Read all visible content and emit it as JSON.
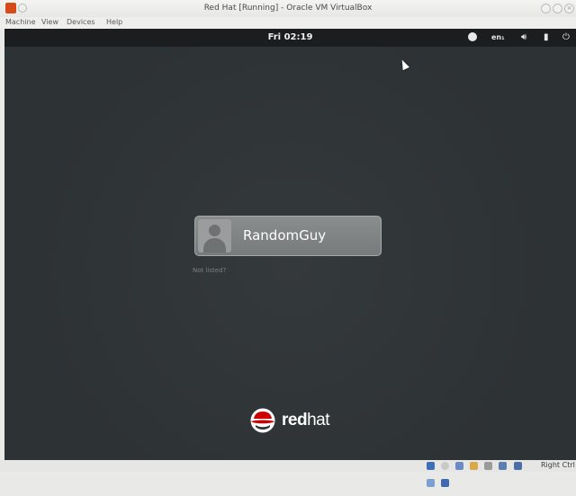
{
  "window": {
    "title": "Red Hat [Running] - Oracle VM VirtualBox",
    "controls": [
      "minimize",
      "maximize",
      "close"
    ]
  },
  "menubar": {
    "items": [
      "Machine",
      "View",
      "Devices",
      "Help"
    ]
  },
  "guest": {
    "topbar": {
      "clock": "Fri 02:19",
      "input_language": "en₁",
      "icons": [
        "accessibility-icon",
        "keyboard-layout-indicator",
        "volume-icon",
        "battery-icon",
        "power-icon"
      ]
    },
    "login": {
      "user_name": "RandomGuy",
      "not_listed_label": "Not listed?"
    },
    "branding": {
      "logo_text_bold": "red",
      "logo_text_light": "hat"
    }
  },
  "statusbar": {
    "host_key_label": "Right Ctrl",
    "device_icons": [
      "hard-disk-icon",
      "optical-drive-icon",
      "usb-icon",
      "shared-folders-icon",
      "display-icon",
      "network-icon",
      "video-capture-icon",
      "mouse-integration-icon",
      "host-key-icon"
    ]
  },
  "colors": {
    "guest_background": "#2e3436",
    "guest_topbar": "#1b1d1e",
    "user_card": "#808384",
    "redhat_red": "#cc0000"
  }
}
